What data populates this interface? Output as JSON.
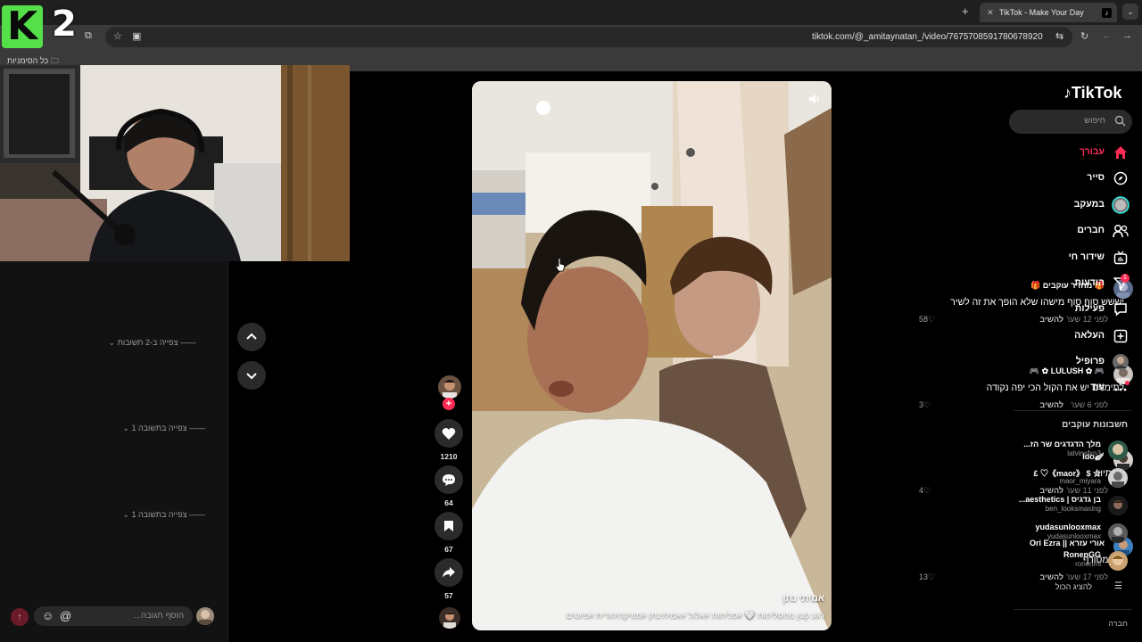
{
  "overlay": {
    "logo_letter": "K",
    "logo_number": "2"
  },
  "browser": {
    "tab_title": "TikTok - Make Your Day",
    "url": "tiktok.com/@_amitaynatan_/video/7675708591780678920",
    "bookmarks_label": "כל הסימניות"
  },
  "comments": [
    {
      "name": "מחזיר עוקבים",
      "name_deco": "🎁",
      "text": "יששש סוף סוף מישהו שלא הופך את זה לשיר",
      "time": "לפני 12 שעו'",
      "reply": "להשיב",
      "likes": "58",
      "view_replies": "צפייה ב-2 תשובות"
    },
    {
      "name": "LULUSH",
      "name_deco": "🎮",
      "text": "לתימנים יש את הקול הכי יפה נקודה",
      "time": "לפני 6 שעו'",
      "reply": "להשיב",
      "likes": "3",
      "view_replies": "צפייה בתשובה 1"
    },
    {
      "name": "Ido",
      "name_deco": "🪽",
      "text": "מסתיווו",
      "time": "לפני 11 שעו'",
      "reply": "להשיב",
      "likes": "4",
      "view_replies": "צפייה בתשובה 1"
    },
    {
      "name": "אורי עזרא || Ori Ezra",
      "name_deco": "",
      "text": "קול מטורף",
      "time": "לפני 17 שעו'",
      "reply": "להשיב",
      "likes": "13",
      "view_replies": ""
    }
  ],
  "comment_box": {
    "placeholder": "הוסף תגובה...",
    "at": "@"
  },
  "actions": {
    "likes": "1210",
    "comments": "64",
    "saves": "67",
    "shares": "57"
  },
  "video": {
    "author": "אמיתי נתן",
    "caption": "רגע קטן מהסליחות 🤍 #סליחות #אלול #אמיתינתן #מוזיקהיהודית #פיוטים"
  },
  "sidebar": {
    "brand": "TikTok",
    "search_placeholder": "חיפוש",
    "nav": [
      {
        "label": "עבורך",
        "icon": "home-icon",
        "active": true
      },
      {
        "label": "סייר",
        "icon": "compass-icon"
      },
      {
        "label": "במעקב",
        "icon": "following-avatar-icon"
      },
      {
        "label": "חברים",
        "icon": "friends-icon"
      },
      {
        "label": "שידור חי",
        "icon": "live-icon"
      },
      {
        "label": "הודעות",
        "icon": "messages-icon",
        "badge": "1"
      },
      {
        "label": "פעילות",
        "icon": "activity-icon"
      },
      {
        "label": "העלאה",
        "icon": "upload-icon"
      },
      {
        "label": "פרופיל",
        "icon": "profile-avatar-icon"
      },
      {
        "label": "עוד",
        "icon": "more-icon",
        "dot": true
      }
    ],
    "following_header": "חשבונות עוקבים",
    "following": [
      {
        "name": "מלך הדגדגים שר הז...",
        "handle": "latvinsfxn3"
      },
      {
        "name": "☆ $ 《maor》♡ £",
        "handle": "maor_miyara"
      },
      {
        "name": "בן גדגיס | aesthetics...",
        "handle": "ben_looksmaxing"
      },
      {
        "name": "yudasunlooxmax",
        "handle": "yudasunlooxmax"
      },
      {
        "name": "RonenGG",
        "handle": "ronenml"
      }
    ],
    "show_all": "להציג הכול",
    "company": "חברה"
  }
}
